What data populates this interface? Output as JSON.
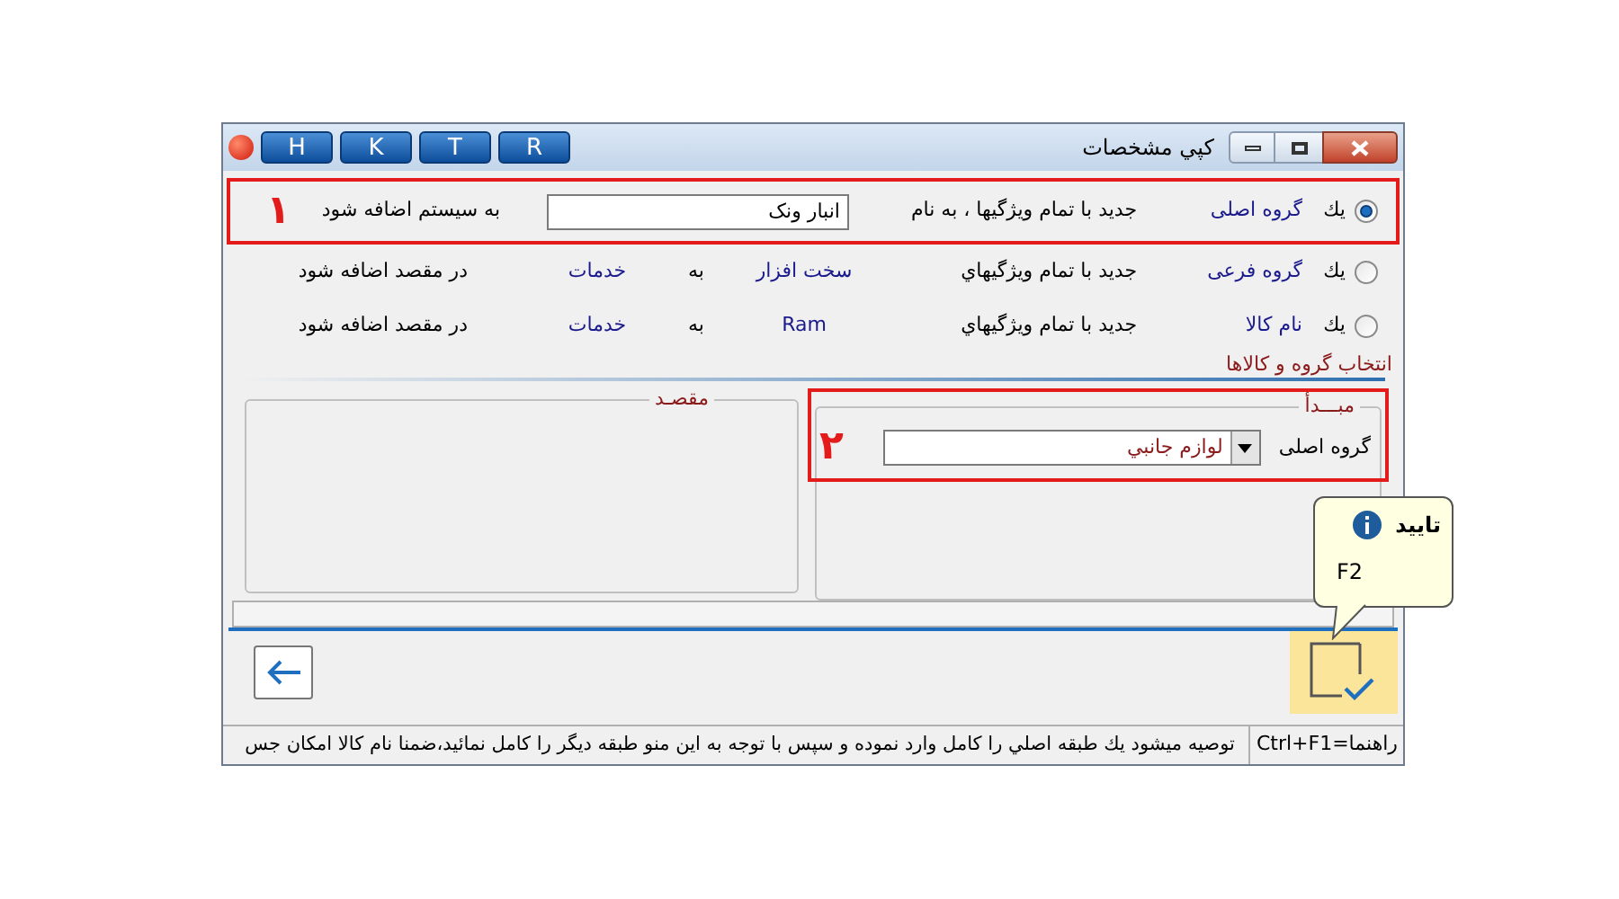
{
  "window": {
    "title": "كپي مشخصات",
    "toolbar_buttons": [
      "R",
      "T",
      "K",
      "H"
    ]
  },
  "progress": {
    "level": 0
  },
  "options": [
    {
      "kind": "input",
      "selected": true,
      "prefix": "يك",
      "item": "گروه اصلی",
      "middle": "جديد با تمام ويژگيها ، به نام",
      "value": "انبار ونک",
      "suffix": "به سيستم اضافه شود",
      "marker": "۱"
    },
    {
      "kind": "transfer",
      "selected": false,
      "prefix": "يك",
      "item": "گروه فرعی",
      "middle": "جديد با تمام ويژگيهاي",
      "source": "سخت افزار",
      "to": "به",
      "target": "خدمات",
      "suffix": "در مقصد اضافه شود"
    },
    {
      "kind": "transfer",
      "selected": false,
      "prefix": "يك",
      "item": "نام كالا",
      "middle": "جديد با تمام ويژگيهاي",
      "source": "Ram",
      "to": "به",
      "target": "خدمات",
      "suffix": "در مقصد اضافه شود"
    }
  ],
  "section_title": "انتخاب گروه و كالاها",
  "source_panel": {
    "legend": "مبـــدأ",
    "label": "گروه اصلی",
    "value": "لوازم جانبي",
    "marker": "۲"
  },
  "dest_panel": {
    "legend": "مقصـد"
  },
  "tooltip": {
    "title": "تاييد",
    "shortcut": "F2"
  },
  "status_bar": {
    "shortcut": "راهنما=Ctrl+F1",
    "message": "توصيه ميشود يك طبقه اصلي را كامل وارد نموده و سپس با توجه به اين منو طبقه ديگر را كامل نمائيد،ضمنا نام كالا امكان جس"
  }
}
